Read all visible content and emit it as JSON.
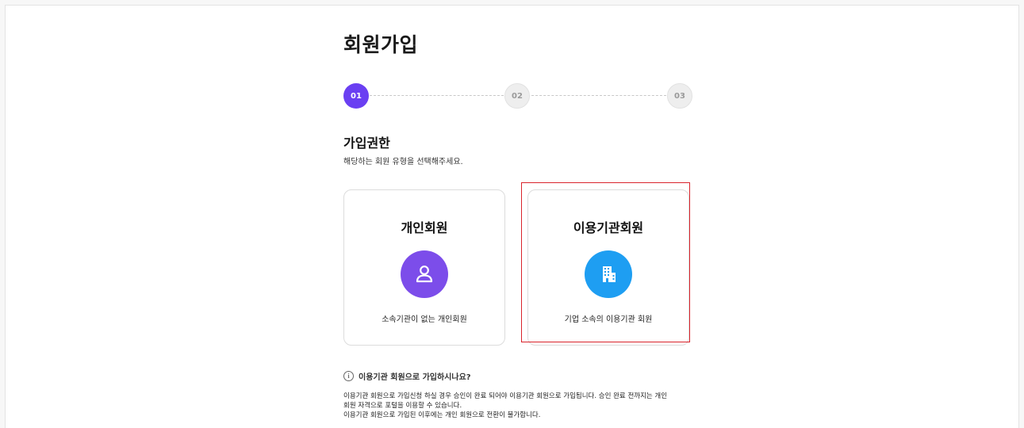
{
  "page": {
    "title": "회원가입"
  },
  "stepper": {
    "steps": [
      {
        "label": "01",
        "active": true
      },
      {
        "label": "02",
        "active": false
      },
      {
        "label": "03",
        "active": false
      }
    ]
  },
  "section": {
    "title": "가입권한",
    "description": "해당하는 회원 유형을 선택해주세요."
  },
  "cards": [
    {
      "title": "개인회원",
      "description": "소속기관이 없는 개인회원",
      "icon": "person-icon",
      "color": "#7c4dea"
    },
    {
      "title": "이용기관회원",
      "description": "기업 소속의 이용기관 회원",
      "icon": "building-icon",
      "color": "#1e9ef2"
    }
  ],
  "info": {
    "title": "이용기관 회원으로 가입하시나요?",
    "icon": "info-icon",
    "lines": [
      "이용기관 회원으로 가입신청 하실 경우 승인이 완료 되어야 이용기관 회원으로 가입됩니다. 승인 완료 전까지는 개인",
      "회원 자격으로 포털을 이용할 수 있습니다.",
      "이용기관 회원으로 가입된 이후에는 개인 회원으로 전환이 불가합니다."
    ]
  },
  "colors": {
    "accent": "#6a3ff2",
    "highlight": "#d9232b"
  }
}
